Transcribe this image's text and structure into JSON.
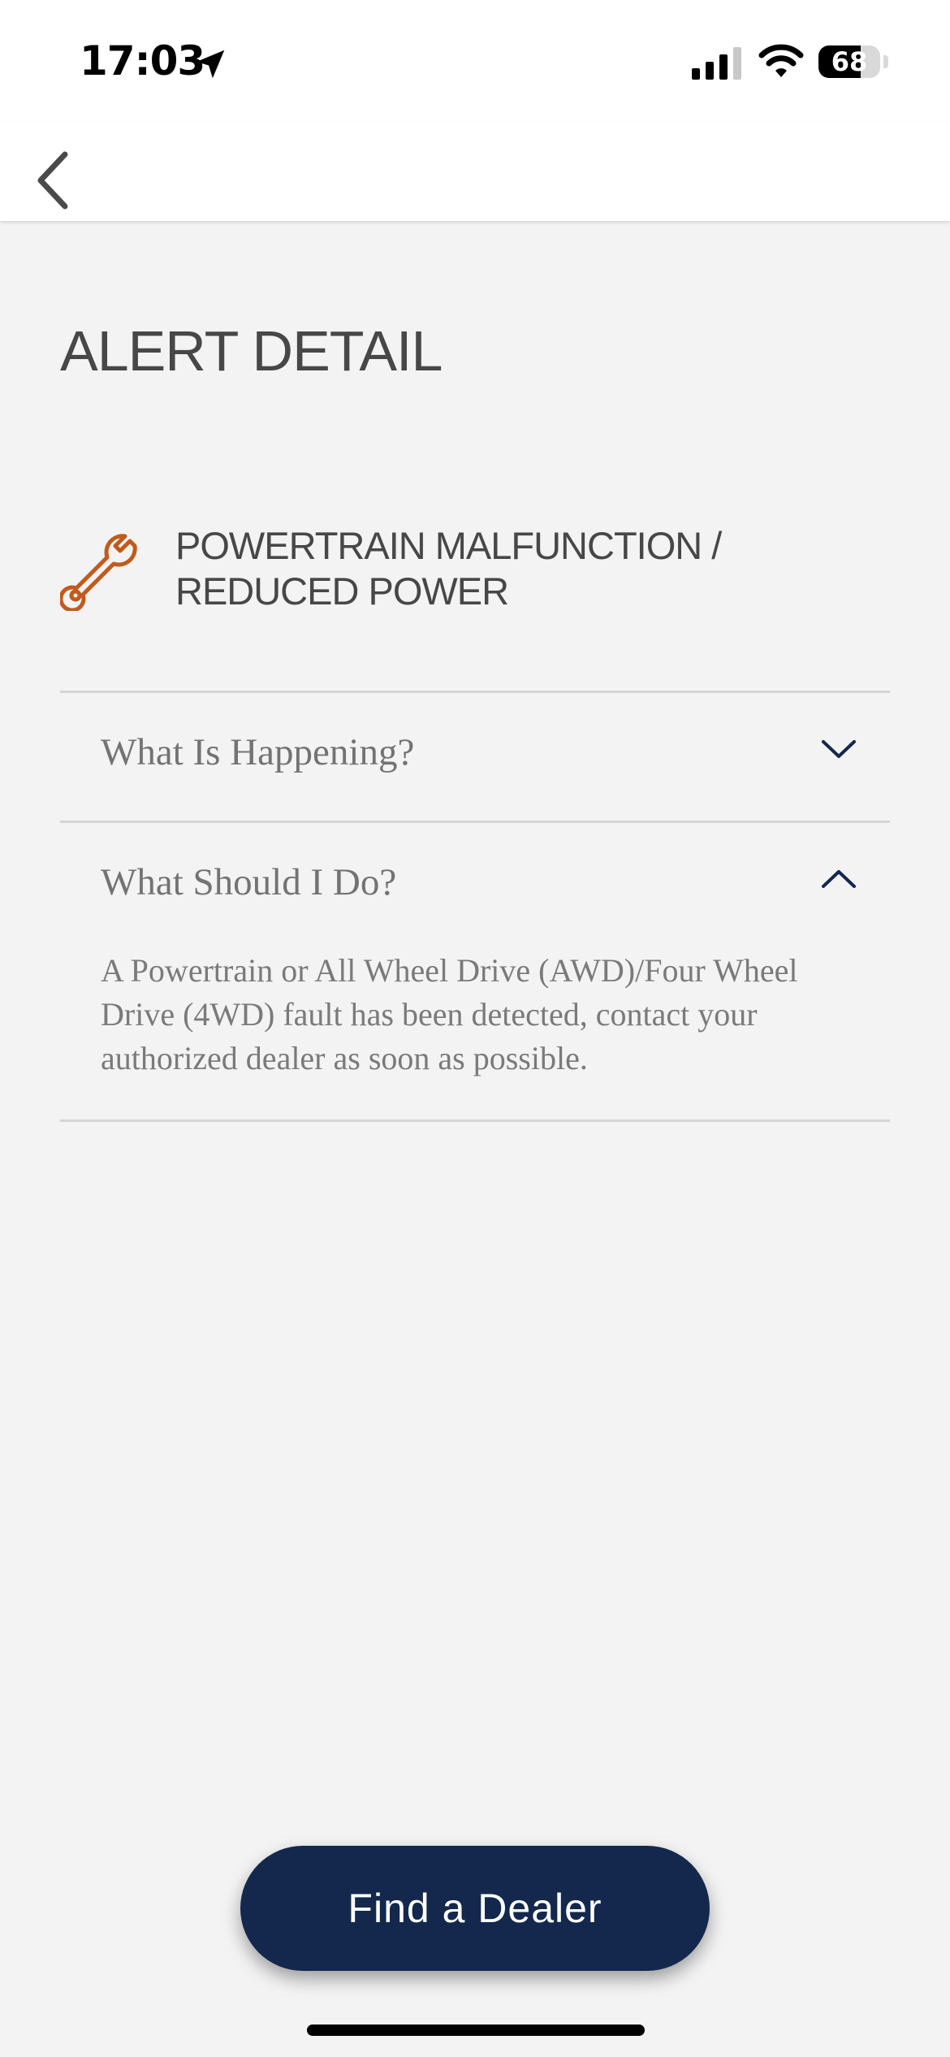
{
  "status_bar": {
    "time": "17:03",
    "battery_level": 68,
    "battery_label": "68",
    "icons": [
      "location-arrow-icon",
      "cellular-signal-icon",
      "wifi-icon",
      "battery-icon"
    ]
  },
  "nav": {
    "back_icon": "chevron-left-icon"
  },
  "page": {
    "title": "ALERT DETAIL"
  },
  "alert": {
    "icon": "wrench-icon",
    "icon_color": "#c15a1c",
    "name_line1": "POWERTRAIN MALFUNCTION /",
    "name_line2": "REDUCED POWER"
  },
  "accordion": {
    "sections": [
      {
        "title": "What Is Happening?",
        "expanded": false,
        "icon": "chevron-down-icon"
      },
      {
        "title": "What Should I Do?",
        "expanded": true,
        "icon": "chevron-up-icon",
        "body": "A Powertrain or All Wheel Drive (AWD)/Four Wheel Drive (4WD) fault has been detected, contact your authorized dealer as soon as possible."
      }
    ]
  },
  "actions": {
    "find_dealer_label": "Find a Dealer",
    "button_color": "#13284c"
  }
}
